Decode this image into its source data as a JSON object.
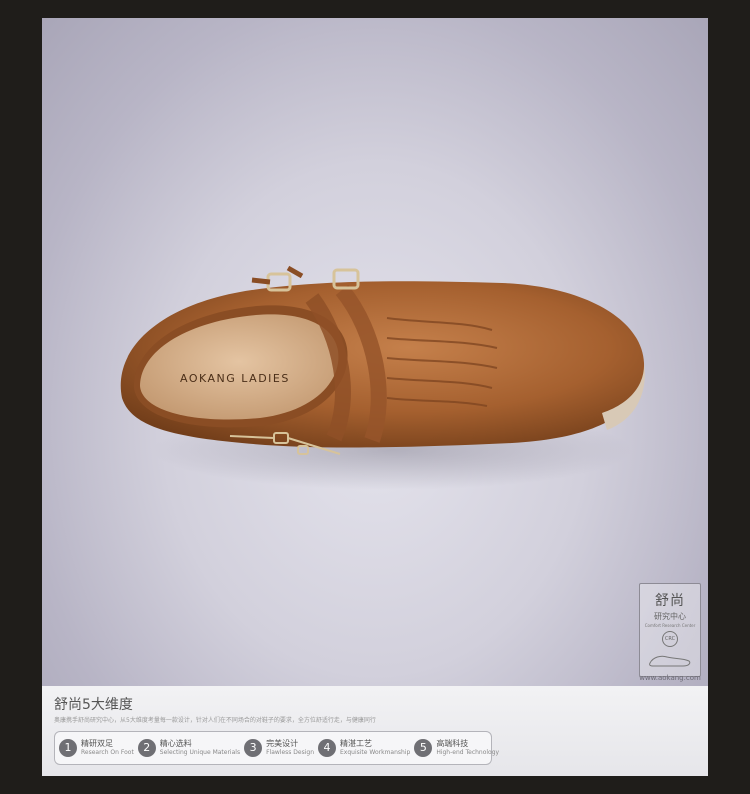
{
  "brand_on_insole": "AOKANG LADIES",
  "badge": {
    "title": "舒尚",
    "subtitle": "研究中心",
    "tiny": "Comfort Research Center",
    "circle": "CRC",
    "url": "www.aokang.com"
  },
  "section": {
    "title": "舒尚5大维度",
    "description": "奥康携手舒尚研究中心，从5大维度考量每一款设计，针对人们在不同场合的对鞋子的要求，全方位舒适行走，与健康同行"
  },
  "features": [
    {
      "num": "1",
      "cn": "精研双足",
      "en": "Research On Foot"
    },
    {
      "num": "2",
      "cn": "精心选料",
      "en": "Selecting Unique Materials"
    },
    {
      "num": "3",
      "cn": "完美设计",
      "en": "Flawless Design"
    },
    {
      "num": "4",
      "cn": "精湛工艺",
      "en": "Exquisite Workmanship"
    },
    {
      "num": "5",
      "cn": "高端科技",
      "en": "High-end Technology"
    }
  ],
  "colors": {
    "leather": "#a5602f",
    "background": "#d2d0dc",
    "frame": "#1f1d1a"
  }
}
